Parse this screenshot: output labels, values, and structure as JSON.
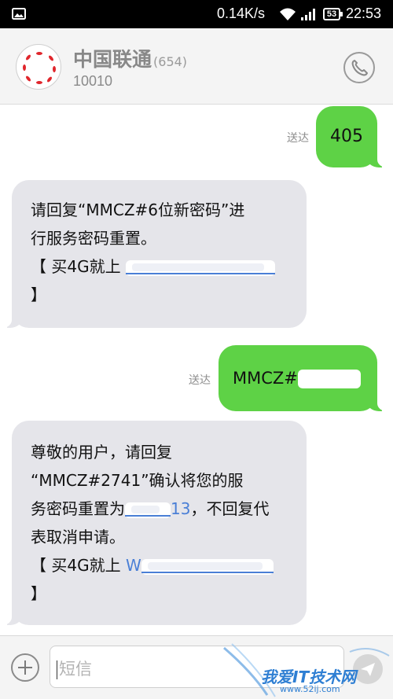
{
  "status_bar": {
    "speed": "0.14K/s",
    "battery": "53",
    "time": "22:53",
    "icons": [
      "photo-icon",
      "wifi-icon",
      "signal-icon",
      "battery-icon"
    ]
  },
  "header": {
    "contact_name": "中国联通",
    "message_count": "(654)",
    "contact_number": "10010",
    "call_icon": "phone-icon"
  },
  "messages": [
    {
      "direction": "out",
      "status": "送达",
      "text": "405"
    },
    {
      "direction": "in",
      "lines": [
        "请回复“MMCZ#6位新密码”进",
        "行服务密码重置。",
        "【 买4G就上",
        "】"
      ]
    },
    {
      "direction": "out",
      "status": "送达",
      "text": "MMCZ#"
    },
    {
      "direction": "in",
      "lines": [
        "尊敬的用户，请回复",
        "“MMCZ#2741”确认将您的服",
        "务密码重置为",
        "13",
        "，不回复代",
        "表取消申请。",
        "【 买4G就上",
        "W",
        "】"
      ]
    }
  ],
  "input": {
    "placeholder": "短信",
    "add_icon": "plus-icon",
    "send_icon": "send-icon"
  },
  "watermark": {
    "text": "我爱IT技术网",
    "url": "www.52ij.com"
  },
  "colors": {
    "outgoing_bubble": "#5ed246",
    "incoming_bubble": "#e5e5ea",
    "link": "#4a7fd6"
  }
}
